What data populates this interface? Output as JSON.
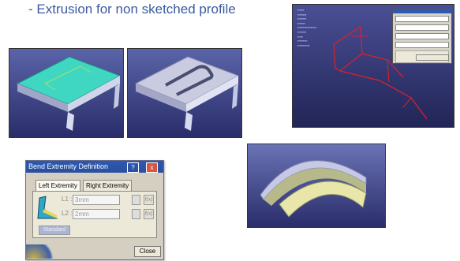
{
  "title": "- Extrusion for non sketched profile",
  "dialog": {
    "title": "Bend Extremity Definition",
    "help_btn": "?",
    "close_x": "x",
    "tab_left": "Left Extremity",
    "tab_right": "Right Extremity",
    "l1_label": "L1 :",
    "l1_value": "3mm",
    "l2_label": "L2 :",
    "l2_value": "2mm",
    "fx": "f(x)",
    "standard": "Standard",
    "close": "Close"
  },
  "colors": {
    "title": "#3a5ba0",
    "viewport_top": "#5a64a8",
    "viewport_bottom": "#2a2d6a",
    "titlebar": "#2c59b3"
  }
}
